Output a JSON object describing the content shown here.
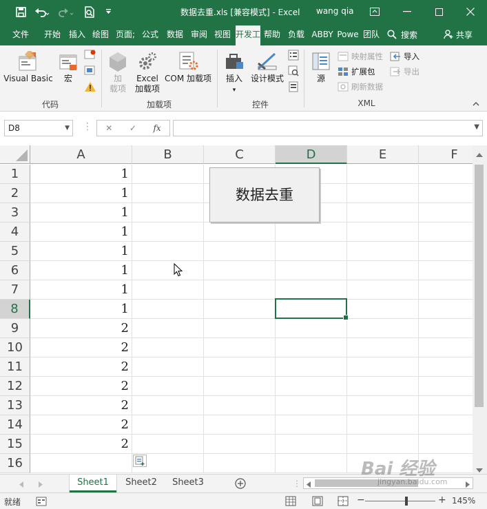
{
  "colors": {
    "excel_green": "#217346",
    "ribbon_bg": "#f3f3f3",
    "grid_line": "#e1e1e1"
  },
  "titlebar": {
    "title": "数据去重.xls  [兼容模式]  -  Excel",
    "user": "wang qia",
    "icons": [
      "save-icon",
      "undo-icon",
      "redo-icon",
      "print-preview-icon",
      "customize-qat-icon",
      "ribbon-display-icon",
      "minimize-icon",
      "maximize-icon",
      "close-icon"
    ]
  },
  "tabs": [
    {
      "label": "文件"
    },
    {
      "label": "开始"
    },
    {
      "label": "插入"
    },
    {
      "label": "绘图"
    },
    {
      "label": "页面;"
    },
    {
      "label": "公式"
    },
    {
      "label": "数据"
    },
    {
      "label": "审阅"
    },
    {
      "label": "视图"
    },
    {
      "label": "开发工"
    },
    {
      "label": "帮助"
    },
    {
      "label": "负载"
    },
    {
      "label": "ABBY"
    },
    {
      "label": "Powe"
    },
    {
      "label": "团队"
    }
  ],
  "search_label": "搜索",
  "share_label": "共享",
  "ribbon": {
    "code": {
      "label": "代码",
      "visual_basic": "Visual Basic",
      "macros": "宏"
    },
    "addins": {
      "label": "加载项",
      "addins_btn_l1": "加",
      "addins_btn_l2": "载项",
      "excel_addins_l1": "Excel",
      "excel_addins_l2": "加载项",
      "com_addins": "COM 加载项"
    },
    "controls": {
      "label": "控件",
      "insert": "插入",
      "design_mode": "设计模式"
    },
    "xml": {
      "label": "XML",
      "source": "源",
      "map_properties": "映射属性",
      "expansion_packs": "扩展包",
      "refresh_data": "刷新数据",
      "import": "导入",
      "export": "导出"
    }
  },
  "formula_bar": {
    "name_box": "D8",
    "cancel": "✕",
    "enter": "✓",
    "fx": "fx",
    "formula": ""
  },
  "columns": [
    "A",
    "B",
    "C",
    "D",
    "E",
    "F"
  ],
  "selected_column": "D",
  "selected_row": 8,
  "rows": [
    {
      "n": "1",
      "a": "1"
    },
    {
      "n": "2",
      "a": "1"
    },
    {
      "n": "3",
      "a": "1"
    },
    {
      "n": "4",
      "a": "1"
    },
    {
      "n": "5",
      "a": "1"
    },
    {
      "n": "6",
      "a": "1"
    },
    {
      "n": "7",
      "a": "1"
    },
    {
      "n": "8",
      "a": "1"
    },
    {
      "n": "9",
      "a": "2"
    },
    {
      "n": "10",
      "a": "2"
    },
    {
      "n": "11",
      "a": "2"
    },
    {
      "n": "12",
      "a": "2"
    },
    {
      "n": "13",
      "a": "2"
    },
    {
      "n": "14",
      "a": "2"
    },
    {
      "n": "15",
      "a": "2"
    },
    {
      "n": "16",
      "a": ""
    }
  ],
  "form_button": "数据去重",
  "sheets": [
    {
      "name": "Sheet1",
      "active": true
    },
    {
      "name": "Sheet2"
    },
    {
      "name": "Sheet3"
    }
  ],
  "status": {
    "ready": "就绪",
    "zoom": "145%",
    "zoom_minus": "−",
    "zoom_plus": "+"
  },
  "watermark": {
    "main": "Bai 经验",
    "sub": "jingyan.baidu.com"
  }
}
